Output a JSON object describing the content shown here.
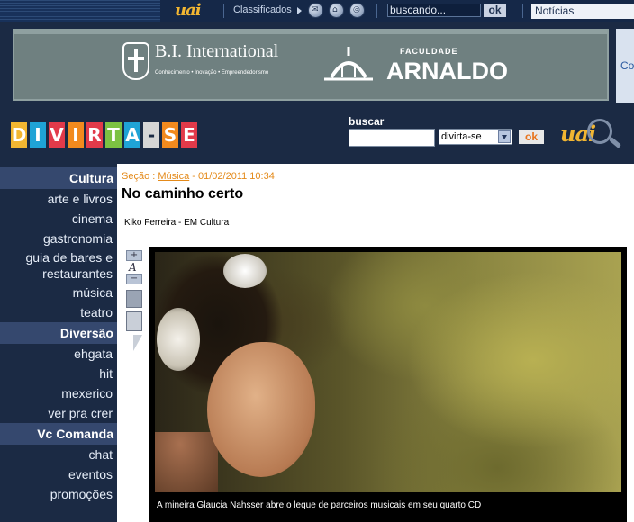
{
  "topbar": {
    "logo_text": "uai",
    "classificados": "Classificados",
    "search_value": "buscando...",
    "ok_label": "ok",
    "noticias_value": "Notícias"
  },
  "banner": {
    "bi_name": "B.I. International",
    "bi_tagline": "Conhecimento • Inovação • Empreendedorismo",
    "faculdade": "FACULDADE",
    "arnaldo": "ARNALDO",
    "side_text": "Co"
  },
  "brand": {
    "letters": [
      "D",
      "I",
      "V",
      "I",
      "R",
      "T",
      "A",
      "-",
      "S",
      "E"
    ],
    "colors": [
      "#f2b632",
      "#1fa3d6",
      "#e23a4a",
      "#f28a1e",
      "#e23a4a",
      "#7cc242",
      "#1fa3d6",
      "#d6d6d6",
      "#f28a1e",
      "#e23a4a"
    ],
    "buscar_label": "buscar",
    "buscar_select": "divirta-se",
    "buscar_ok": "ok",
    "uai_logo": "uai"
  },
  "sidebar": {
    "sections": [
      {
        "title": "Cultura",
        "items": [
          "arte e livros",
          "cinema",
          "gastronomia",
          "guia de bares e restaurantes",
          "música",
          "teatro"
        ]
      },
      {
        "title": "Diversão",
        "items": [
          "ehgata",
          "hit",
          "mexerico",
          "ver pra crer"
        ]
      },
      {
        "title": "Vc Comanda",
        "items": [
          "chat",
          "eventos",
          "promoções"
        ]
      }
    ]
  },
  "article": {
    "secao_label": "Seção :",
    "secao_link": "Música",
    "date": "- 01/02/2011 10:34",
    "title": "No caminho certo",
    "author": "Kiko Ferreira - EM Cultura",
    "caption": "A mineira Glaucia Nahsser abre o leque de parceiros musicais em seu quarto CD",
    "tools": {
      "zoom_in": "+",
      "font": "A",
      "zoom_out": "−"
    }
  }
}
